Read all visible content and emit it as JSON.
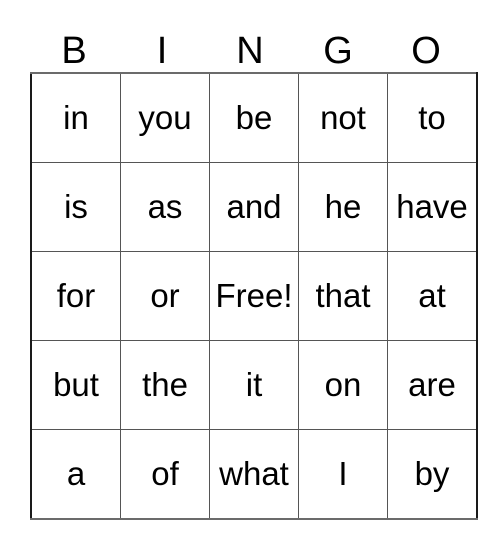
{
  "card": {
    "title": "BINGO",
    "header_letters": [
      "B",
      "I",
      "N",
      "G",
      "O"
    ],
    "free_space_label": "Free!",
    "grid_size": "5x5",
    "colors": {
      "background": "#ffffff",
      "grid_line": "#555555",
      "outer_border": "#1a1a1a",
      "text": "#000000"
    },
    "rows": [
      {
        "cells": [
          {
            "text": "in"
          },
          {
            "text": "you"
          },
          {
            "text": "be"
          },
          {
            "text": "not"
          },
          {
            "text": "to"
          }
        ]
      },
      {
        "cells": [
          {
            "text": "is"
          },
          {
            "text": "as"
          },
          {
            "text": "and"
          },
          {
            "text": "he"
          },
          {
            "text": "have"
          }
        ]
      },
      {
        "cells": [
          {
            "text": "for"
          },
          {
            "text": "or"
          },
          {
            "text": "Free!"
          },
          {
            "text": "that"
          },
          {
            "text": "at"
          }
        ]
      },
      {
        "cells": [
          {
            "text": "but"
          },
          {
            "text": "the"
          },
          {
            "text": "it"
          },
          {
            "text": "on"
          },
          {
            "text": "are"
          }
        ]
      },
      {
        "cells": [
          {
            "text": "a"
          },
          {
            "text": "of"
          },
          {
            "text": "what"
          },
          {
            "text": "I"
          },
          {
            "text": "by"
          }
        ]
      }
    ]
  }
}
